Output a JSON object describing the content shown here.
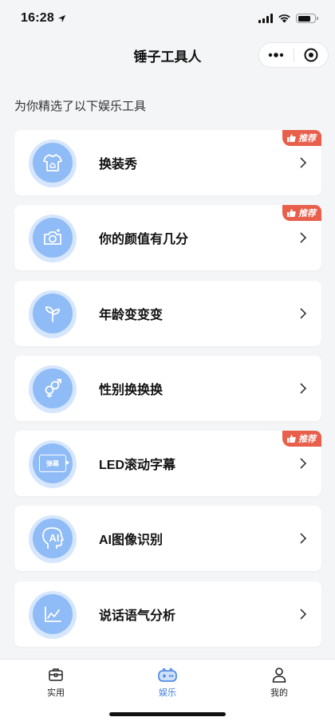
{
  "status_bar": {
    "time": "16:28"
  },
  "nav": {
    "title": "锤子工具人"
  },
  "section_title": "为你精选了以下娱乐工具",
  "tools": [
    {
      "label": "换装秀",
      "icon": "tshirt-icon",
      "badge": "推荐"
    },
    {
      "label": "你的颜值有几分",
      "icon": "camera-icon",
      "badge": "推荐"
    },
    {
      "label": "年龄变变变",
      "icon": "sprout-icon",
      "badge": ""
    },
    {
      "label": "性别换换换",
      "icon": "gender-icon",
      "badge": ""
    },
    {
      "label": "LED滚动字幕",
      "icon": "led-screen-icon",
      "badge": "推荐",
      "icon_text": "弹幕"
    },
    {
      "label": "AI图像识别",
      "icon": "ai-head-icon",
      "badge": "",
      "icon_text": "AI"
    },
    {
      "label": "说话语气分析",
      "icon": "line-chart-icon",
      "badge": ""
    }
  ],
  "tab_bar": {
    "items": [
      {
        "label": "实用",
        "icon": "toolbox-icon",
        "active": false
      },
      {
        "label": "娱乐",
        "icon": "game-controller-icon",
        "active": true
      },
      {
        "label": "我的",
        "icon": "person-icon",
        "active": false
      }
    ]
  },
  "colors": {
    "accent": "#3f7ede",
    "badge": "#e8604c",
    "icon_fill": "#8fbbf6",
    "icon_halo": "#d6e6fd",
    "background": "#f4f5f7"
  }
}
